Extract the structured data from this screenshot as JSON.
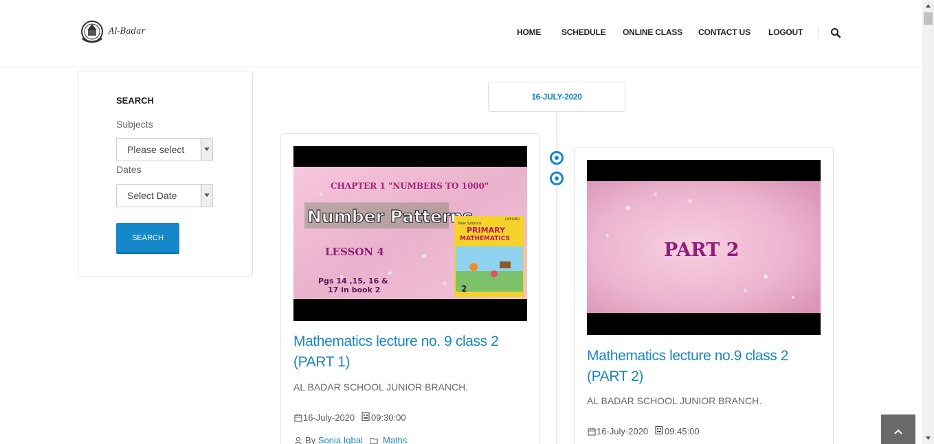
{
  "brand": {
    "name": "Al-Badar"
  },
  "nav": {
    "items": [
      {
        "label": "HOME"
      },
      {
        "label": "SCHEDULE"
      },
      {
        "label": "ONLINE CLASS"
      },
      {
        "label": "CONTACT US"
      },
      {
        "label": "LOGOUT"
      }
    ]
  },
  "sidebar": {
    "title": "SEARCH",
    "subjects_label": "Subjects",
    "subjects_value": "Please select",
    "dates_label": "Dates",
    "dates_value": "Select Date",
    "button_label": "SEARCH"
  },
  "timeline": {
    "date": "16-JULY-2020",
    "accent_color": "#1488c8"
  },
  "lectures": [
    {
      "thumb": {
        "chapter": "CHAPTER 1  \"NUMBERS TO 1000\"",
        "heading": "Number Patterns",
        "lesson": "LESSON 4",
        "pages_line1": "Pgs 14 ,15, 16 &",
        "pages_line2": "17 in book 2",
        "book_series": "New Syllabus",
        "book_title1": "PRIMARY",
        "book_title2": "MATHEMATICS",
        "book_publisher": "OXFORD",
        "book_number": "2"
      },
      "title": "Mathematics lecture no. 9 class 2 (PART 1)",
      "school": "AL BADAR SCHOOL JUNIOR BRANCH.",
      "date": "16-July-2020",
      "time": "09:30:00",
      "by_label": "By",
      "author": "Sonia Iqbal",
      "category": "Maths"
    },
    {
      "thumb": {
        "text": "PART 2"
      },
      "title": "Mathematics lecture no.9 class 2 (PART 2)",
      "school": "AL BADAR SCHOOL JUNIOR BRANCH.",
      "date": "16-July-2020",
      "time": "09:45:00"
    }
  ]
}
